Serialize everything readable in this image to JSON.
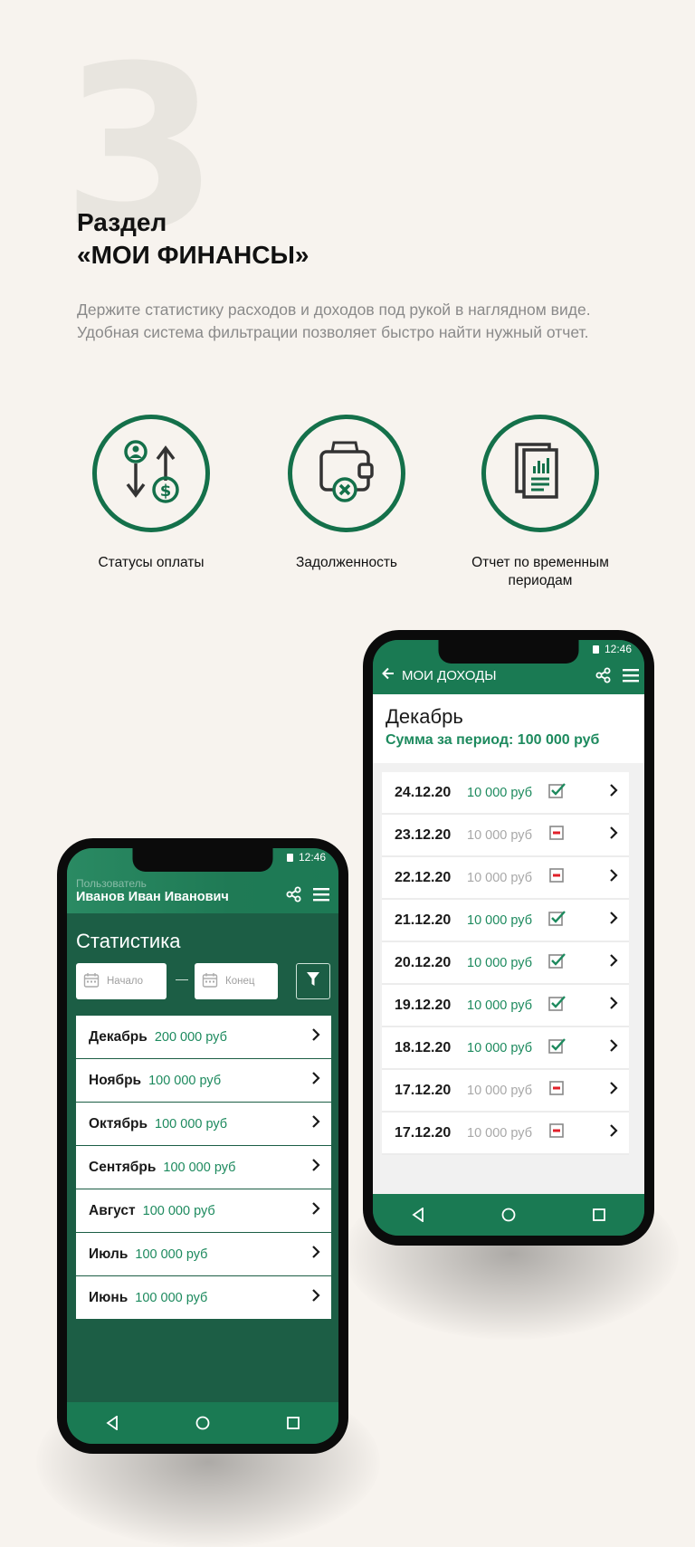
{
  "section": {
    "number": "3",
    "title_line1": "Раздел",
    "title_line2": "«МОИ ФИНАНСЫ»",
    "desc_line1": "Держите статистику расходов и доходов под рукой в наглядном виде.",
    "desc_line2": "Удобная система фильтрации позволяет быстро найти нужный отчет."
  },
  "features": [
    {
      "label": "Статусы оплаты",
      "icon": "payment-status-icon"
    },
    {
      "label": "Задолженность",
      "icon": "wallet-debt-icon"
    },
    {
      "label_line1": "Отчет по временным",
      "label_line2": "периодам",
      "icon": "report-documents-icon"
    }
  ],
  "colors": {
    "brand_green": "#14704a",
    "screen_dark": "#1c5e45",
    "header_green": "#1a7a53",
    "amount_green": "#1d8a5e",
    "status_red": "#e0202a"
  },
  "left_phone": {
    "time": "12:46",
    "user_caption": "Пользователь",
    "user_name": "Иванов Иван Иванович",
    "title": "Статистика",
    "start_placeholder": "Начало",
    "end_placeholder": "Конец",
    "months": [
      {
        "name": "Декабрь",
        "amount": "200 000 руб"
      },
      {
        "name": "Ноябрь",
        "amount": "100 000 руб"
      },
      {
        "name": "Октябрь",
        "amount": "100 000 руб"
      },
      {
        "name": "Сентябрь",
        "amount": "100 000 руб"
      },
      {
        "name": "Август",
        "amount": "100 000 руб"
      },
      {
        "name": "Июль",
        "amount": "100 000 руб"
      },
      {
        "name": "Июнь",
        "amount": "100 000 руб"
      }
    ]
  },
  "right_phone": {
    "time": "12:46",
    "header_title": "МОИ ДОХОДЫ",
    "month": "Декабрь",
    "sum_text": "Сумма за период: 100 000 руб",
    "days": [
      {
        "date": "24.12.20",
        "amount": "10 000 руб",
        "status": "paid"
      },
      {
        "date": "23.12.20",
        "amount": "10 000 руб",
        "status": "unpaid"
      },
      {
        "date": "22.12.20",
        "amount": "10 000 руб",
        "status": "unpaid"
      },
      {
        "date": "21.12.20",
        "amount": "10 000 руб",
        "status": "paid"
      },
      {
        "date": "20.12.20",
        "amount": "10 000 руб",
        "status": "paid"
      },
      {
        "date": "19.12.20",
        "amount": "10 000 руб",
        "status": "paid"
      },
      {
        "date": "18.12.20",
        "amount": "10 000 руб",
        "status": "paid"
      },
      {
        "date": "17.12.20",
        "amount": "10 000 руб",
        "status": "unpaid"
      },
      {
        "date": "17.12.20",
        "amount": "10 000 руб",
        "status": "unpaid"
      }
    ]
  }
}
